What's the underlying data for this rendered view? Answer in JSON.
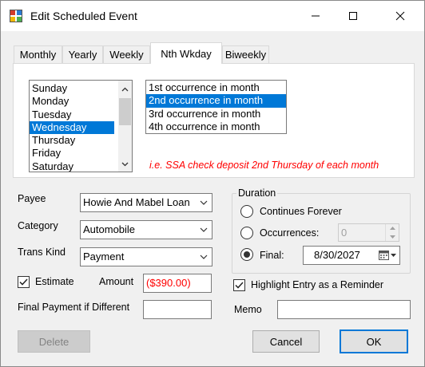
{
  "window": {
    "title": "Edit Scheduled Event"
  },
  "tabs": [
    {
      "label": "Monthly"
    },
    {
      "label": "Yearly"
    },
    {
      "label": "Weekly"
    },
    {
      "label": "Nth Wkday",
      "active": true
    },
    {
      "label": "Biweekly"
    }
  ],
  "weekdays": {
    "items": [
      "Sunday",
      "Monday",
      "Tuesday",
      "Wednesday",
      "Thursday",
      "Friday",
      "Saturday"
    ],
    "selected": "Wednesday"
  },
  "occurrences": {
    "items": [
      "1st occurrence in month",
      "2nd occurrence in month",
      "3rd occurrence in month",
      "4th occurrence in month"
    ],
    "selected": "2nd occurrence in month"
  },
  "hint": "i.e. SSA check deposit 2nd Thursday of each month",
  "form": {
    "payee_label": "Payee",
    "payee_value": "Howie And Mabel Loan",
    "category_label": "Category",
    "category_value": "Automobile",
    "trans_kind_label": "Trans Kind",
    "trans_kind_value": "Payment",
    "estimate_label": "Estimate",
    "estimate_checked": true,
    "amount_label": "Amount",
    "amount_value": "($390.00)",
    "final_payment_label": "Final Payment if Different",
    "final_payment_value": ""
  },
  "duration": {
    "title": "Duration",
    "forever_label": "Continues Forever",
    "occurrences_label": "Occurrences:",
    "occurrences_value": "0",
    "final_label": "Final:",
    "final_date": "8/30/2027",
    "selected": "final"
  },
  "reminder": {
    "label": "Highlight Entry as a Reminder",
    "checked": true
  },
  "memo": {
    "label": "Memo",
    "value": ""
  },
  "buttons": {
    "delete": "Delete",
    "cancel": "Cancel",
    "ok": "OK"
  },
  "colors": {
    "selection": "#0078d7",
    "hint": "#ff0000",
    "amount": "#ff0000",
    "window_bg": "#f0f0f0"
  },
  "icons": [
    "app-icon",
    "minimize-icon",
    "maximize-icon",
    "close-icon",
    "chevron-down-icon",
    "scroll-up-icon",
    "scroll-down-icon",
    "calendar-icon",
    "checkmark-icon"
  ]
}
